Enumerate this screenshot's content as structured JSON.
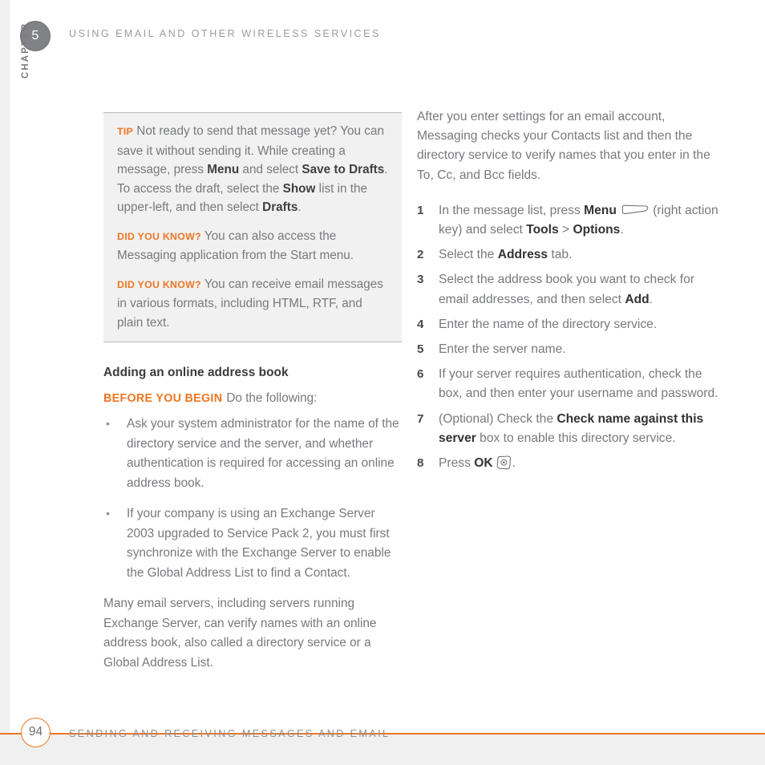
{
  "page": {
    "background_color": "#ffffff",
    "accent_color": "#ef7622",
    "body_text_color": "#77797c",
    "band_color": "#f0f0f0"
  },
  "header": {
    "chapter_badge_number": "5",
    "chapter_word": "CHAPTER",
    "running_title": "USING EMAIL AND OTHER WIRELESS SERVICES"
  },
  "callout": {
    "items": [
      {
        "label": "TIP",
        "runs": [
          {
            "text": " Not ready to send that message yet? You can save it without sending it. While creating a message, press ",
            "bold": false
          },
          {
            "text": "Menu",
            "bold": true
          },
          {
            "text": " and select ",
            "bold": false
          },
          {
            "text": "Save to Drafts",
            "bold": true
          },
          {
            "text": ". To access the draft, select the ",
            "bold": false
          },
          {
            "text": "Show",
            "bold": true
          },
          {
            "text": " list in the upper-left, and then select ",
            "bold": false
          },
          {
            "text": "Drafts",
            "bold": true
          },
          {
            "text": ".",
            "bold": false
          }
        ]
      },
      {
        "label": "DID YOU KNOW?",
        "runs": [
          {
            "text": "  You can also access the Messaging application from the Start menu.",
            "bold": false
          }
        ]
      },
      {
        "label": "DID YOU KNOW?",
        "runs": [
          {
            "text": "  You can receive email messages in various formats, including HTML, RTF, and plain text.",
            "bold": false
          }
        ]
      }
    ]
  },
  "left_column": {
    "subheading": "Adding an online address book",
    "before_you_begin": {
      "tag": "BEFORE YOU BEGIN",
      "text": "Do the following:"
    },
    "bullets": [
      "Ask your system administrator for the name of the directory service and the server, and whether authentication is required for accessing an online address book.",
      "If your company is using an Exchange Server 2003 upgraded to Service Pack 2, you must first synchronize with the Exchange Server to enable the Global Address List to find a Contact."
    ],
    "closing_paragraph": "Many email servers, including servers running Exchange Server, can verify names with an online address book, also called a directory service or a Global Address List."
  },
  "right_column": {
    "intro": "After you enter settings for an email account, Messaging checks your Contacts list and then the directory service to verify names that you enter in the To, Cc, and Bcc fields.",
    "steps": [
      {
        "number": "1",
        "runs": [
          {
            "text": "In the message list, press ",
            "bold": false
          },
          {
            "text": "Menu",
            "bold": true
          },
          {
            "text": "ICON:menu-key-icon",
            "bold": false
          },
          {
            "text": " (right action key) and select ",
            "bold": false
          },
          {
            "text": "Tools",
            "bold": true
          },
          {
            "text": " > ",
            "bold": false
          },
          {
            "text": "Options",
            "bold": true
          },
          {
            "text": ".",
            "bold": false
          }
        ]
      },
      {
        "number": "2",
        "runs": [
          {
            "text": "Select the ",
            "bold": false
          },
          {
            "text": "Address",
            "bold": true
          },
          {
            "text": " tab.",
            "bold": false
          }
        ]
      },
      {
        "number": "3",
        "runs": [
          {
            "text": "Select the address book you want to check for email addresses, and then select ",
            "bold": false
          },
          {
            "text": "Add",
            "bold": true
          },
          {
            "text": ".",
            "bold": false
          }
        ]
      },
      {
        "number": "4",
        "runs": [
          {
            "text": "Enter the name of the directory service.",
            "bold": false
          }
        ]
      },
      {
        "number": "5",
        "runs": [
          {
            "text": "Enter the server name.",
            "bold": false
          }
        ]
      },
      {
        "number": "6",
        "runs": [
          {
            "text": "If your server requires authentication, check the box, and then enter your username and password.",
            "bold": false
          }
        ]
      },
      {
        "number": "7",
        "runs": [
          {
            "text": "(Optional) Check the ",
            "bold": false
          },
          {
            "text": "Check name against this server",
            "bold": true
          },
          {
            "text": " box to enable this directory service.",
            "bold": false
          }
        ]
      },
      {
        "number": "8",
        "runs": [
          {
            "text": "Press ",
            "bold": false
          },
          {
            "text": "OK",
            "bold": true
          },
          {
            "text": "ICON:ok-key-icon",
            "bold": false
          },
          {
            "text": ".",
            "bold": false
          }
        ]
      }
    ]
  },
  "footer": {
    "page_number": "94",
    "title": "SENDING AND RECEIVING MESSAGES AND EMAIL"
  }
}
